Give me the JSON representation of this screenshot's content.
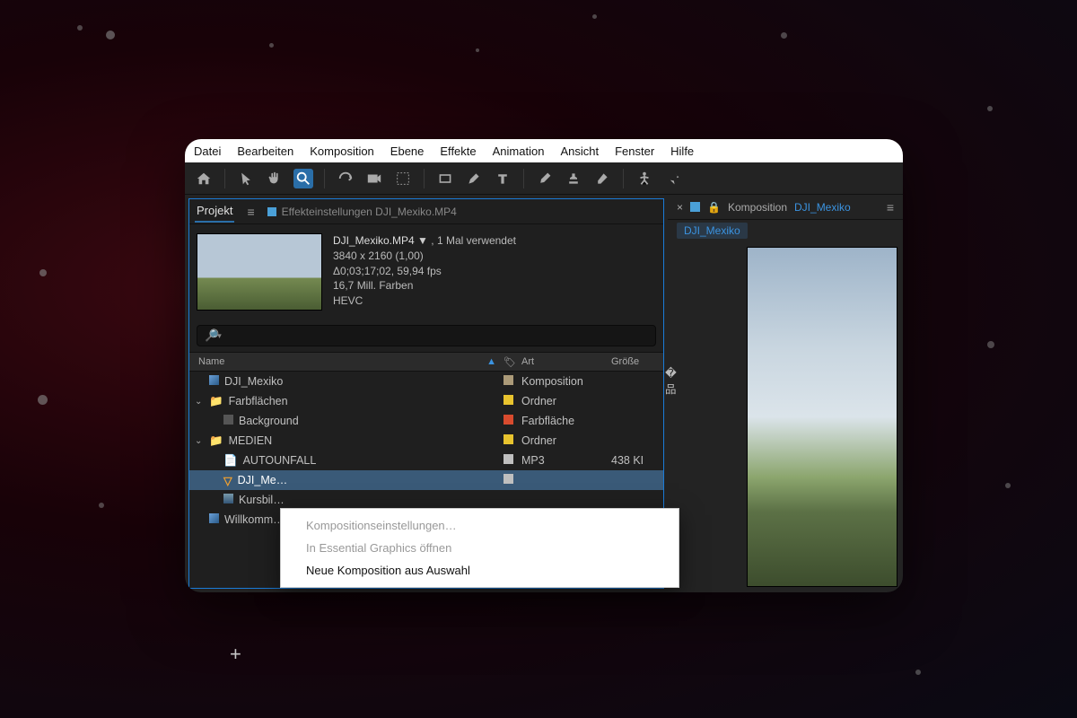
{
  "menubar": [
    "Datei",
    "Bearbeiten",
    "Komposition",
    "Ebene",
    "Effekte",
    "Animation",
    "Ansicht",
    "Fenster",
    "Hilfe"
  ],
  "toolbar_icons": [
    "home",
    "selection",
    "hand",
    "zoom",
    "orbit",
    "camera",
    "roi",
    "rect",
    "pen",
    "type",
    "brush",
    "stamp",
    "eraser",
    "puppet",
    "pin"
  ],
  "active_tool": "zoom",
  "project_panel": {
    "tab": "Projekt",
    "secondary_tab": "Effekteinstellungen  DJI_Mexiko.MP4",
    "file": {
      "name": "DJI_Mexiko.MP4",
      "usage": ", 1 Mal verwendet",
      "resolution": "3840 x 2160 (1,00)",
      "duration": "Δ0;03;17;02, 59,94 fps",
      "colors": "16,7 Mill. Farben",
      "codec": "HEVC"
    },
    "search_icon": "🔎",
    "columns": {
      "name": "Name",
      "tag": "",
      "art": "Art",
      "size": "Größe"
    },
    "rows": [
      {
        "indent": 0,
        "icon": "comp",
        "name": "DJI_Mexiko",
        "tag": "#ab9a78",
        "art": "Komposition",
        "size": "",
        "flow": true
      },
      {
        "indent": 0,
        "icon": "folder",
        "name": "Farbflächen",
        "tag": "#e8c32e",
        "art": "Ordner",
        "size": "",
        "expand": true
      },
      {
        "indent": 1,
        "icon": "solid",
        "name": "Background",
        "tag": "#d84b2e",
        "art": "Farbfläche",
        "size": ""
      },
      {
        "indent": 0,
        "icon": "folder",
        "name": "MEDIEN",
        "tag": "#e8c32e",
        "art": "Ordner",
        "size": "",
        "expand": true
      },
      {
        "indent": 1,
        "icon": "audio",
        "name": "AUTOUNFALL",
        "tag": "#bfbfbf",
        "art": "MP3",
        "size": "438 KI"
      },
      {
        "indent": 1,
        "icon": "video",
        "name": "DJI_Me…",
        "tag": "#bfbfbf",
        "art": "",
        "size": "",
        "selected": true
      },
      {
        "indent": 1,
        "icon": "image",
        "name": "Kursbil…",
        "tag": "",
        "art": "",
        "size": ""
      },
      {
        "indent": 0,
        "icon": "comp",
        "name": "Willkomm…",
        "tag": "",
        "art": "",
        "size": ""
      }
    ]
  },
  "context_menu": {
    "items": [
      {
        "label": "Kompositionseinstellungen…",
        "enabled": false
      },
      {
        "label": "In Essential Graphics öffnen",
        "enabled": false
      },
      {
        "label": "Neue Komposition aus Auswahl",
        "enabled": true
      }
    ]
  },
  "composition_panel": {
    "prefix": "Komposition",
    "name": "DJI_Mexiko",
    "breadcrumb": "DJI_Mexiko"
  }
}
